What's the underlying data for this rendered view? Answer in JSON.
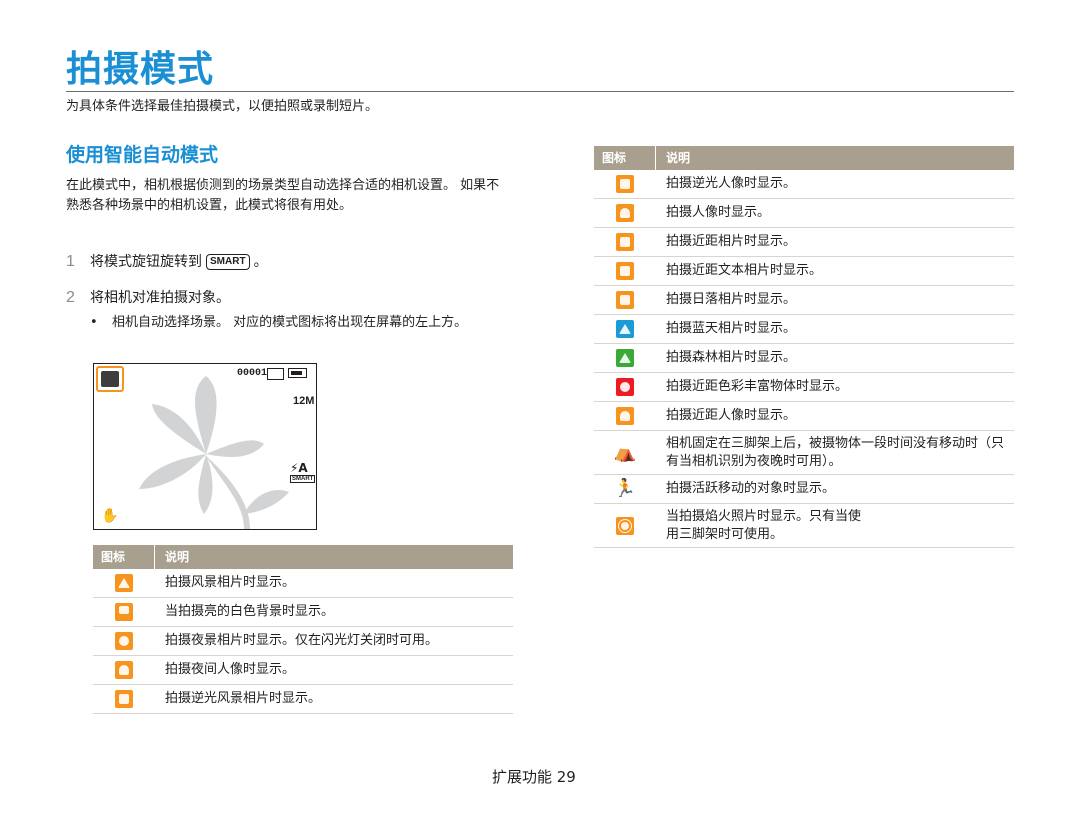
{
  "page": {
    "title": "拍摄模式",
    "intro": "为具体条件选择最佳拍摄模式，以便拍照或录制短片。",
    "footer": "扩展功能 29"
  },
  "section": {
    "title": "使用智能自动模式",
    "description": "在此模式中，相机根据侦测到的场景类型自动选择合适的相机设置。 如果不熟悉各种场景中的相机设置，此模式将很有用处。"
  },
  "steps": [
    {
      "num": "1",
      "text_before": "将模式旋钮旋转到",
      "badge": "SMART",
      "text_after": "。"
    },
    {
      "num": "2",
      "text": "将相机对准拍摄对象。"
    }
  ],
  "bullet": {
    "symbol": "•",
    "text": "相机自动选择场景。 对应的模式图标将出现在屏幕的左上方。"
  },
  "camera_screen": {
    "counter": "00001",
    "resolution": "12M",
    "flash": "⚡A",
    "smart_label": "SMART",
    "stabilizer_icon": "hand-stabilizer-icon"
  },
  "table_left": {
    "headers": [
      "图标",
      "说明"
    ],
    "rows": [
      {
        "icon": "landscape-icon",
        "text": "拍摄风景相片时显示。"
      },
      {
        "icon": "white-background-icon",
        "text": "当拍摄亮的白色背景时显示。"
      },
      {
        "icon": "night-icon",
        "text": "拍摄夜景相片时显示。仅在闪光灯关闭时可用。"
      },
      {
        "icon": "night-portrait-icon",
        "text": "拍摄夜间人像时显示。"
      },
      {
        "icon": "backlit-landscape-icon",
        "text": "拍摄逆光风景相片时显示。"
      }
    ]
  },
  "table_right": {
    "headers": [
      "图标",
      "说明"
    ],
    "rows": [
      {
        "icon": "backlit-portrait-icon",
        "text": "拍摄逆光人像时显示。"
      },
      {
        "icon": "portrait-icon",
        "text": "拍摄人像时显示。"
      },
      {
        "icon": "macro-icon",
        "text": "拍摄近距相片时显示。"
      },
      {
        "icon": "macro-text-icon",
        "text": "拍摄近距文本相片时显示。"
      },
      {
        "icon": "sunset-icon",
        "text": "拍摄日落相片时显示。"
      },
      {
        "icon": "blue-sky-icon",
        "text": "拍摄蓝天相片时显示。"
      },
      {
        "icon": "forest-icon",
        "text": "拍摄森林相片时显示。"
      },
      {
        "icon": "macro-color-icon",
        "text": "拍摄近距色彩丰富物体时显示。"
      },
      {
        "icon": "macro-portrait-icon",
        "text": "拍摄近距人像时显示。"
      },
      {
        "icon": "tripod-icon",
        "text": "相机固定在三脚架上后，被摄物体一段时间没有移动时（只有当相机识别为夜晚时可用）。"
      },
      {
        "icon": "action-icon",
        "text": "拍摄活跃移动的对象时显示。"
      },
      {
        "icon": "fireworks-icon",
        "text": "当拍摄焰火照片时显示。只有当使用三脚架时可使用。"
      }
    ]
  },
  "colors": {
    "accent": "#1a8fd4",
    "table_header": "#a99f8e",
    "icon_orange": "#f7941d",
    "icon_blue": "#1b9ad6",
    "icon_green": "#3aa935",
    "icon_red": "#ed1c24"
  }
}
